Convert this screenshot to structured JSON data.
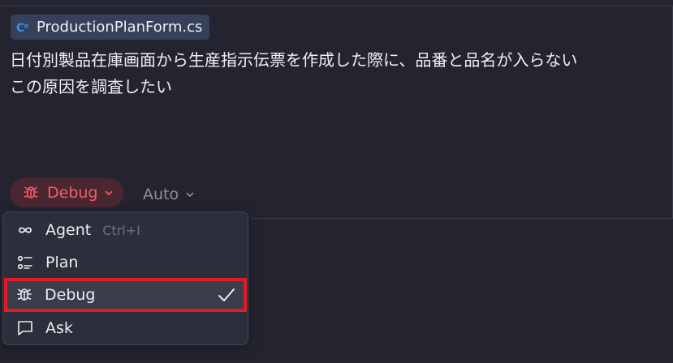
{
  "context_chip": {
    "icon": "csharp-file-icon",
    "filename": "ProductionPlanForm.cs"
  },
  "prompt": {
    "line1": "日付別製品在庫画面から生産指示伝票を作成した際に、品番と品名が入らない",
    "line2": "この原因を調査したい"
  },
  "mode_selector": {
    "icon": "bug-icon",
    "label": "Debug",
    "accent_color": "#ef5d6a"
  },
  "model_selector": {
    "label": "Auto"
  },
  "mode_menu": {
    "items": [
      {
        "icon": "infinity-icon",
        "label": "Agent",
        "shortcut": "Ctrl+I"
      },
      {
        "icon": "plan-list-icon",
        "label": "Plan"
      },
      {
        "icon": "bug-icon",
        "label": "Debug",
        "selected": true
      },
      {
        "icon": "chat-bubble-icon",
        "label": "Ask"
      }
    ]
  },
  "highlight_color": "#e01b24"
}
